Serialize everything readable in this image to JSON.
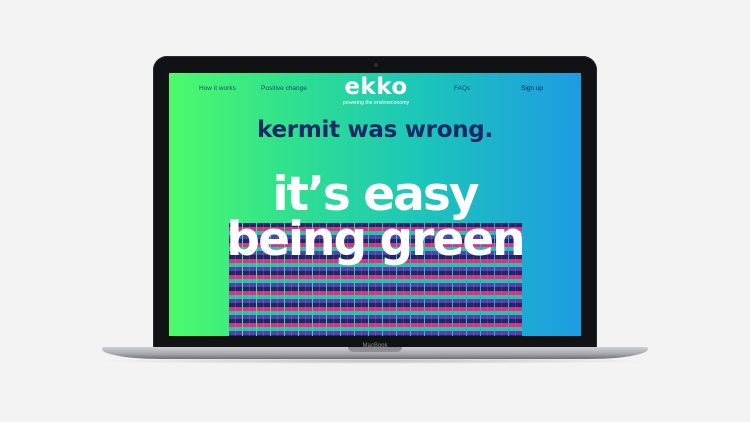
{
  "nav": {
    "how_it_works": "How it works",
    "positive_change": "Positive change",
    "faqs": "FAQs",
    "sign_up": "Sign up"
  },
  "logo": {
    "word": "ekko",
    "tagline": "powering the enviroeconomy"
  },
  "hero": {
    "tagline": "kermit was wrong.",
    "headline_line1": "it’s easy",
    "headline_line2": "being green"
  },
  "device": {
    "brand_label": "MacBook"
  },
  "colors": {
    "gradient_start": "#4dfa6b",
    "gradient_end": "#1e9be3",
    "tagline_color": "#1b2a66",
    "stripe_colors": [
      "#1a2a66",
      "#e32b8c",
      "#2bc4a1",
      "#5b3db2"
    ]
  }
}
